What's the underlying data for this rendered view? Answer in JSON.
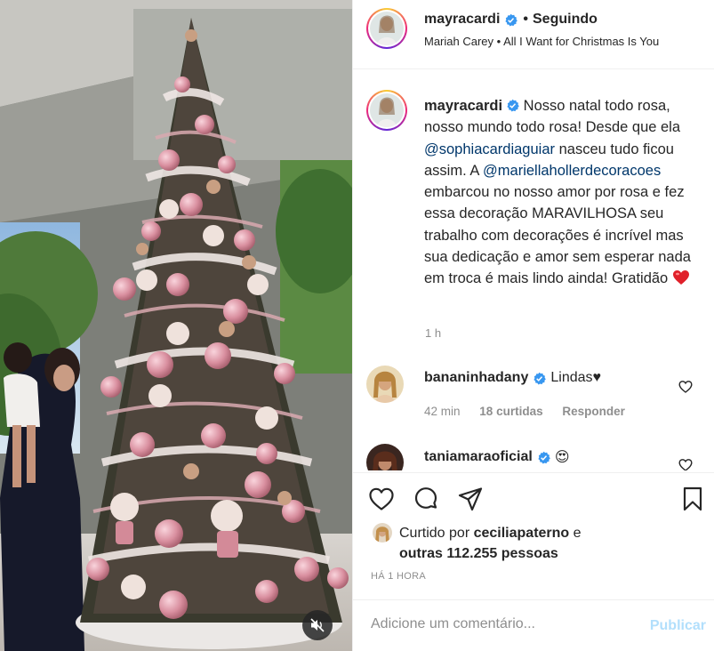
{
  "post": {
    "author": "mayracardi",
    "follow_status": "Seguindo",
    "separator": "•",
    "song": {
      "artist": "Mariah Carey",
      "separator": "•",
      "title": "All I Want for Christmas Is You"
    }
  },
  "caption": {
    "username": "mayracardi",
    "part1": " Nosso natal todo rosa, nosso mundo todo rosa! Desde que ela ",
    "mention1": "@sophiacardiaguiar",
    "part2": " nasceu tudo ficou assim. A ",
    "mention2": "@mariellahollerdecoracoes",
    "part3": " embarcou no nosso amor por rosa e fez essa decoração MARAVILHOSA seu trabalho com decorações é incrível mas sua dedicação e amor sem esperar nada em troca é mais lindo ainda! Gratidão ",
    "time": "1 h"
  },
  "comments": [
    {
      "username": "bananinhadany",
      "text": "Lindas♥",
      "time": "42 min",
      "likes": "18 curtidas",
      "reply": "Responder"
    },
    {
      "username": "taniamaraoficial",
      "text": "😍"
    }
  ],
  "likes": {
    "prefix": "Curtido por ",
    "user": "ceciliapaterno",
    "conj": " e",
    "others": "outras 112.255 pessoas"
  },
  "posted_ago": "HÁ 1 HORA",
  "add_comment": {
    "placeholder": "Adicione um comentário...",
    "publish": "Publicar"
  },
  "colors": {
    "verified": "#3897f0",
    "link": "#00376b",
    "muted": "#8e8e8e",
    "publish_disabled": "#b2dffc",
    "heart": "#ed4956"
  },
  "icons": {
    "like": "heart-outline-icon",
    "comment": "speech-bubble-icon",
    "share": "paper-plane-icon",
    "save": "bookmark-icon",
    "mute": "speaker-muted-icon"
  }
}
